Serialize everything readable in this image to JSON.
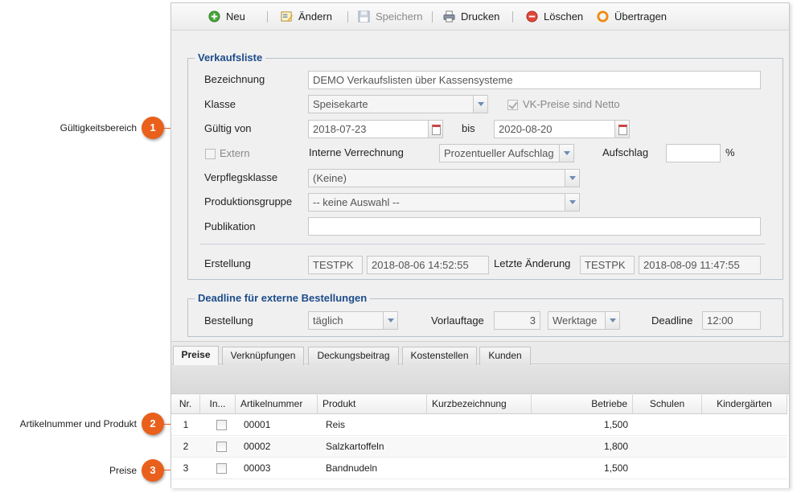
{
  "callouts": [
    {
      "num": "1",
      "label": "Gültigkeitsbereich"
    },
    {
      "num": "2",
      "label": "Artikelnummer und Produkt"
    },
    {
      "num": "3",
      "label": "Preise"
    }
  ],
  "toolbar": {
    "new_label": "Neu",
    "edit_label": "Ändern",
    "save_label": "Speichern",
    "print_label": "Drucken",
    "delete_label": "Löschen",
    "transfer_label": "Übertragen"
  },
  "verkaufsliste": {
    "legend": "Verkaufsliste",
    "bezeichnung_label": "Bezeichnung",
    "bezeichnung_value": "DEMO Verkaufslisten über Kassensysteme",
    "klasse_label": "Klasse",
    "klasse_value": "Speisekarte",
    "vk_netto_label": "VK-Preise sind Netto",
    "gueltig_label": "Gültig von",
    "gueltig_von": "2018-07-23",
    "bis_label": "bis",
    "gueltig_bis": "2020-08-20",
    "extern_label": "Extern",
    "interne_verrechnung_label": "Interne Verrechnung",
    "interne_verrechnung_value": "Prozentueller Aufschlag",
    "aufschlag_label": "Aufschlag",
    "aufschlag_value": "",
    "percent_label": "%",
    "verpflegsklasse_label": "Verpflegsklasse",
    "verpflegsklasse_value": "(Keine)",
    "produktionsgruppe_label": "Produktionsgruppe",
    "produktionsgruppe_value": "-- keine Auswahl --",
    "publikation_label": "Publikation",
    "publikation_value": "",
    "erstellung_label": "Erstellung",
    "erstellung_user": "TESTPK",
    "erstellung_date": "2018-08-06 14:52:55",
    "letzte_aenderung_label": "Letzte Änderung",
    "aenderung_user": "TESTPK",
    "aenderung_date": "2018-08-09 11:47:55"
  },
  "deadline": {
    "legend": "Deadline für externe Bestellungen",
    "bestellung_label": "Bestellung",
    "bestellung_value": "täglich",
    "vorlauftage_label": "Vorlauftage",
    "vorlauftage_value": "3",
    "tage_typ_value": "Werktage",
    "deadline_label": "Deadline",
    "deadline_value": "12:00"
  },
  "tabs": [
    {
      "label": "Preise"
    },
    {
      "label": "Verknüpfungen"
    },
    {
      "label": "Deckungsbeitrag"
    },
    {
      "label": "Kostenstellen"
    },
    {
      "label": "Kunden"
    }
  ],
  "grid": {
    "columns": [
      "Nr.",
      "In...",
      "Artikelnummer",
      "Produkt",
      "Kurzbezeichnung",
      "Betriebe",
      "Schulen",
      "Kindergärten"
    ],
    "rows": [
      {
        "nr": "1",
        "artikelnummer": "00001",
        "produkt": "Reis",
        "kurzbezeichnung": "",
        "betriebe": "1,500",
        "schulen": "",
        "kindergaerten": ""
      },
      {
        "nr": "2",
        "artikelnummer": "00002",
        "produkt": "Salzkartoffeln",
        "kurzbezeichnung": "",
        "betriebe": "1,800",
        "schulen": "",
        "kindergaerten": ""
      },
      {
        "nr": "3",
        "artikelnummer": "00003",
        "produkt": "Bandnudeln",
        "kurzbezeichnung": "",
        "betriebe": "1,500",
        "schulen": "",
        "kindergaerten": ""
      }
    ]
  },
  "colors": {
    "callout": "#e8601c",
    "legend_text": "#1e4c8a"
  }
}
